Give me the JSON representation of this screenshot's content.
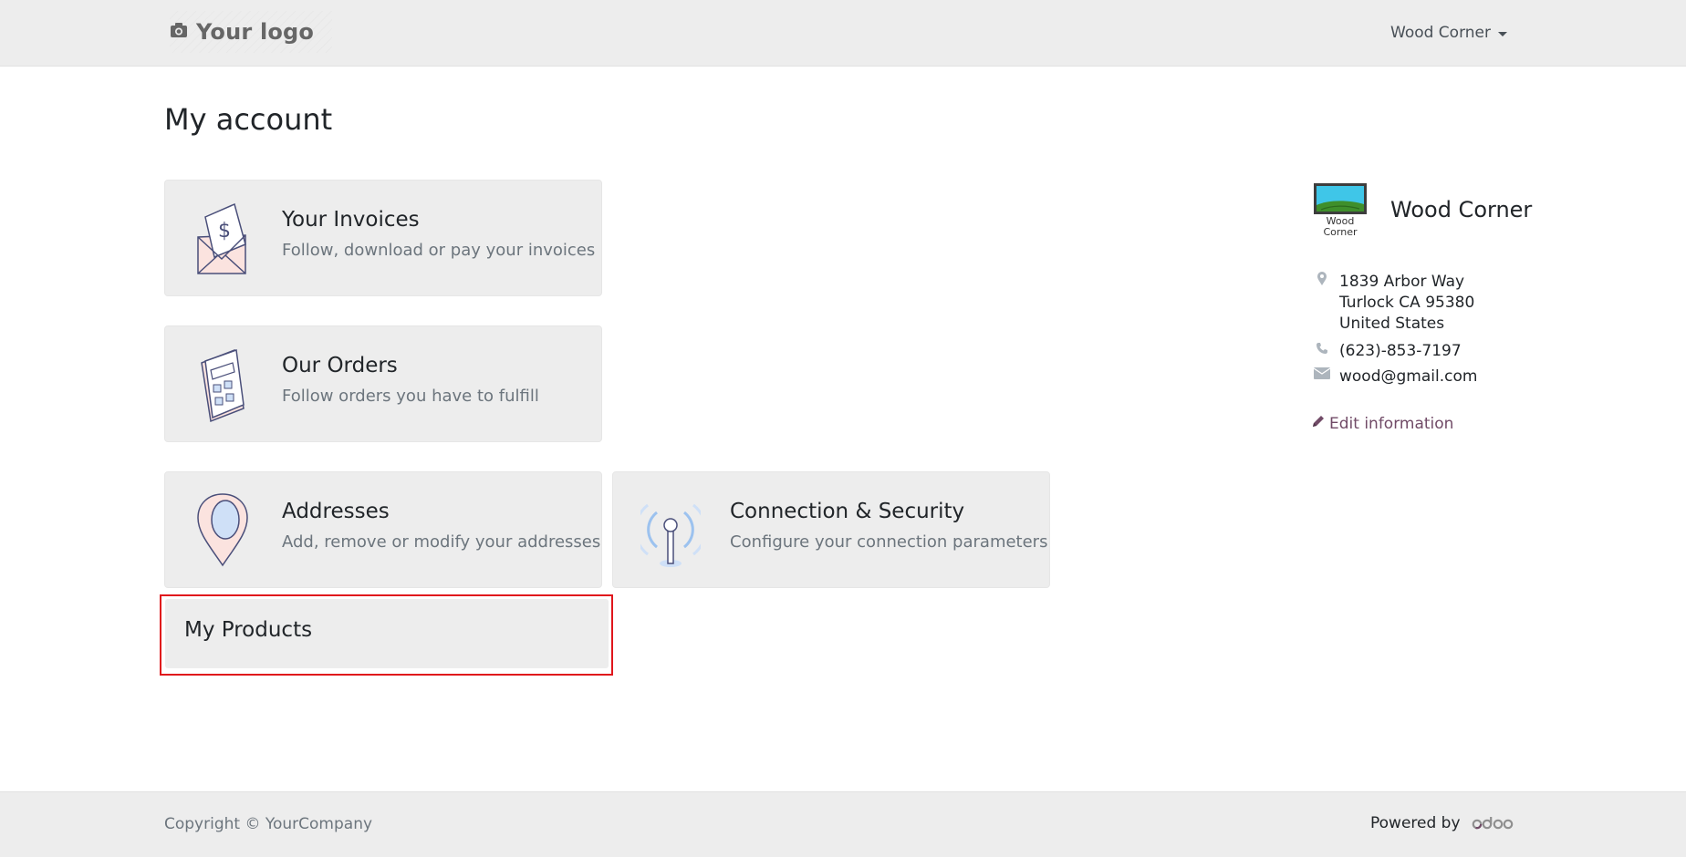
{
  "header": {
    "logo_text": "Your logo",
    "logo_icon": "camera-icon",
    "user_name": "Wood Corner"
  },
  "page": {
    "title": "My account"
  },
  "cards": {
    "invoices": {
      "title": "Your Invoices",
      "subtitle": "Follow, download or pay your invoices",
      "icon": "invoice-envelope-icon"
    },
    "orders": {
      "title": "Our Orders",
      "subtitle": "Follow orders you have to fulfill",
      "icon": "calculator-icon"
    },
    "addresses": {
      "title": "Addresses",
      "subtitle": "Add, remove or modify your addresses",
      "icon": "map-pin-icon"
    },
    "connection": {
      "title": "Connection & Security",
      "subtitle": "Configure your connection parameters",
      "icon": "antenna-icon"
    },
    "products": {
      "title": "My Products"
    }
  },
  "company": {
    "name": "Wood Corner",
    "logo_text_1": "Wood",
    "logo_text_2": "Corner",
    "address_line1": "1839 Arbor Way",
    "address_line2": "Turlock CA 95380",
    "address_line3": "United States",
    "phone": "(623)-853-7197",
    "email": "wood@gmail.com",
    "edit_label": "Edit information"
  },
  "footer": {
    "copyright": "Copyright © YourCompany",
    "powered_by": "Powered by",
    "brand": "odoo"
  },
  "colors": {
    "header_bg": "#ededed",
    "card_bg": "#ededed",
    "link": "#714b67",
    "highlight_border": "#e0161c"
  }
}
